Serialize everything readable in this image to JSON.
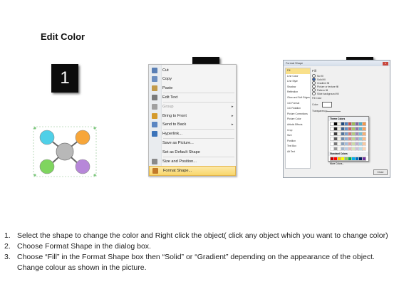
{
  "title": "Edit Color",
  "steps": [
    "1",
    "2",
    "3"
  ],
  "diagram": {
    "colors": {
      "top_left": "#4fd0e8",
      "top_right": "#f7a63a",
      "bottom_left": "#7fd55f",
      "bottom_right": "#b787d9",
      "center": "#b8b8b8"
    }
  },
  "context_menu": {
    "items": [
      {
        "label": "Cut",
        "icon": "scissors-icon",
        "disabled": false,
        "submenu": false
      },
      {
        "label": "Copy",
        "icon": "copy-icon",
        "disabled": false,
        "submenu": false
      },
      {
        "label": "Paste",
        "icon": "paste-icon",
        "disabled": false,
        "submenu": false
      },
      {
        "label": "Edit Text",
        "icon": "edit-text-icon",
        "disabled": false,
        "submenu": false
      },
      {
        "label": "Group",
        "icon": "group-icon",
        "disabled": true,
        "submenu": true
      },
      {
        "label": "Bring to Front",
        "icon": "bring-front-icon",
        "disabled": false,
        "submenu": true
      },
      {
        "label": "Send to Back",
        "icon": "send-back-icon",
        "disabled": false,
        "submenu": true
      },
      {
        "label": "Hyperlink...",
        "icon": "hyperlink-icon",
        "disabled": false,
        "submenu": false
      },
      {
        "label": "Save as Picture...",
        "icon": "",
        "disabled": false,
        "submenu": false
      },
      {
        "label": "Set as Default Shape",
        "icon": "",
        "disabled": false,
        "submenu": false
      },
      {
        "label": "Size and Position...",
        "icon": "size-icon",
        "disabled": false,
        "submenu": false
      },
      {
        "label": "Format Shape...",
        "icon": "format-shape-icon",
        "disabled": false,
        "submenu": false,
        "highlighted": true
      }
    ]
  },
  "format_dialog": {
    "title": "Format Shape",
    "close_glyph": "x",
    "nav": [
      "Fill",
      "Line Color",
      "Line Style",
      "Shadow",
      "Reflection",
      "Glow and Soft Edges",
      "3-D Format",
      "3-D Rotation",
      "Picture Corrections",
      "Picture Color",
      "Artistic Effects",
      "Crop",
      "Size",
      "Position",
      "Text Box",
      "Alt Text"
    ],
    "fill_heading": "Fill",
    "fill_options": [
      "No fill",
      "Solid fill",
      "Gradient fill",
      "Picture or texture fill",
      "Pattern fill",
      "Slide background fill"
    ],
    "fill_color_heading": "Fill Color",
    "color_label": "Color:",
    "transparency_label": "Transparency:",
    "close_button": "Close",
    "palette": {
      "theme_heading": "Theme Colors",
      "standard_heading": "Standard Colors",
      "more_label": "More Colors..."
    }
  },
  "instructions": [
    {
      "num": "1.",
      "text": "Select the shape to change the color and Right click the object( click any object which you want to change color)"
    },
    {
      "num": "2.",
      "text": "Choose Format Shape in the dialog box."
    },
    {
      "num": "3.",
      "text": "Choose “Fill” in the Format Shape box then “Solid” or “Gradient” depending on the appearance of the object. Change colour as shown in the picture."
    }
  ]
}
